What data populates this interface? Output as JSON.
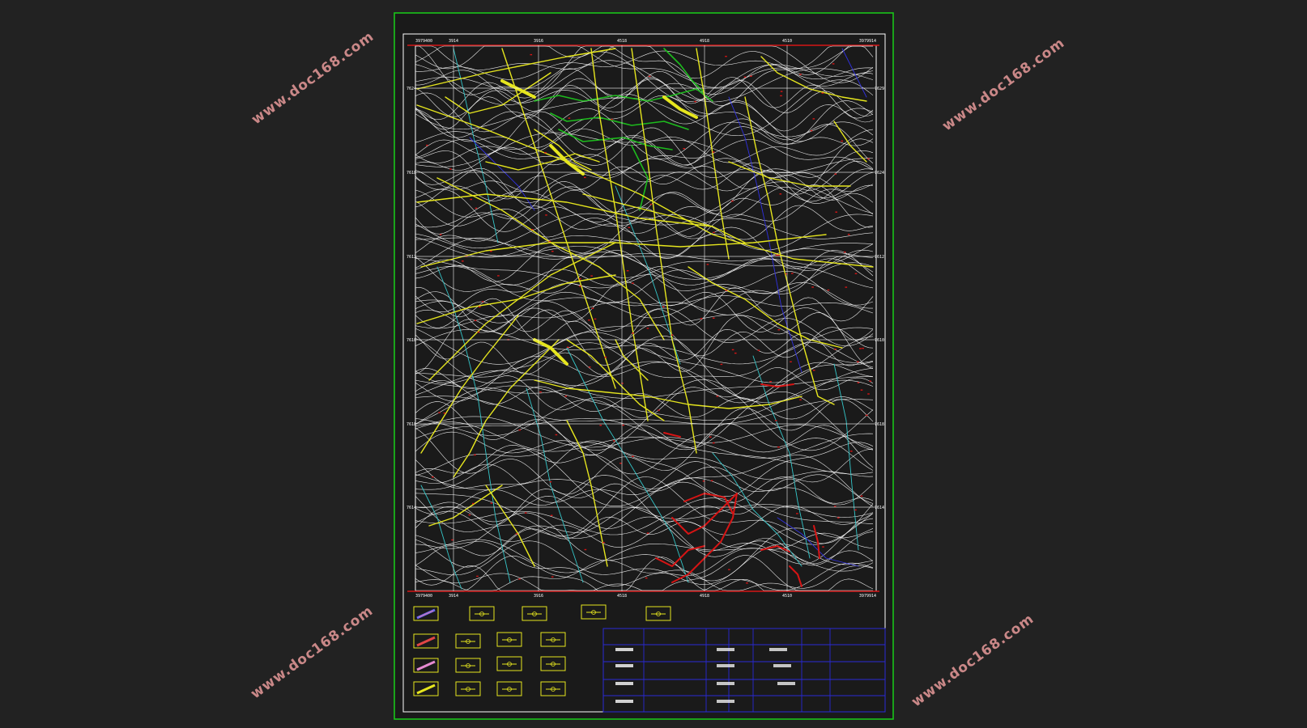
{
  "watermark": {
    "text": "www.doc168.com",
    "color": "#e89a9a"
  },
  "colors": {
    "background": "#222222",
    "sheet_background": "#1a1a1a",
    "outer_frame": "#19c419",
    "inner_frame": "#ffffff",
    "contour": "#ffffff",
    "roads": "#e6e61e",
    "rivers": "#34c6c9",
    "green_zone": "#1dbb1d",
    "red_zone": "#d61414",
    "blue_lines": "#3030e0",
    "title_block": "#2a2ad6",
    "grid": "#ffffff"
  },
  "map": {
    "top_coordinates": [
      "3979400",
      "3914",
      "3916",
      "4518",
      "4918",
      "4510",
      "3979914"
    ],
    "bottom_coordinates": [
      "3979400",
      "3914",
      "3916",
      "4518",
      "4918",
      "4510",
      "3979914"
    ],
    "left_coordinates": [
      "",
      "7624",
      "7618",
      "7612",
      "7610",
      "7618",
      "7614",
      ""
    ],
    "right_coordinates": [
      "",
      "7629",
      "7624",
      "7612",
      "7610",
      "7618",
      "7614",
      ""
    ]
  },
  "legend": {
    "symbols": [
      {
        "name": "legend-symbol-1",
        "icon": "blue-pink-stroke-icon"
      },
      {
        "name": "legend-symbol-2",
        "icon": "yellow-box-icon"
      },
      {
        "name": "legend-symbol-3",
        "icon": "yellow-circle-box-icon"
      },
      {
        "name": "legend-symbol-4",
        "icon": "yellow-stroke-box-icon"
      },
      {
        "name": "legend-symbol-5",
        "icon": "yellow-empty-box-icon"
      },
      {
        "name": "legend-symbol-6",
        "icon": "red-stroke-icon"
      },
      {
        "name": "legend-symbol-7",
        "icon": "yellow-cross-box-icon"
      },
      {
        "name": "legend-symbol-8",
        "icon": "yellow-grid-box-icon"
      },
      {
        "name": "legend-symbol-9",
        "icon": "yellow-line-box-icon"
      },
      {
        "name": "legend-symbol-10",
        "icon": "pink-stroke-icon"
      },
      {
        "name": "legend-symbol-11",
        "icon": "yellow-dot-box-icon"
      },
      {
        "name": "legend-symbol-12",
        "icon": "yellow-tree-box-icon"
      },
      {
        "name": "legend-symbol-13",
        "icon": "yellow-target-box-icon"
      },
      {
        "name": "legend-symbol-14",
        "icon": "yellow-stroke-icon"
      },
      {
        "name": "legend-symbol-15",
        "icon": "yellow-slash-box-icon"
      },
      {
        "name": "legend-symbol-16",
        "icon": "yellow-oval-box-icon"
      },
      {
        "name": "legend-symbol-17",
        "icon": "yellow-lines-box-icon"
      }
    ]
  },
  "title_block": {
    "rows": [
      "",
      "",
      "",
      "",
      ""
    ]
  }
}
